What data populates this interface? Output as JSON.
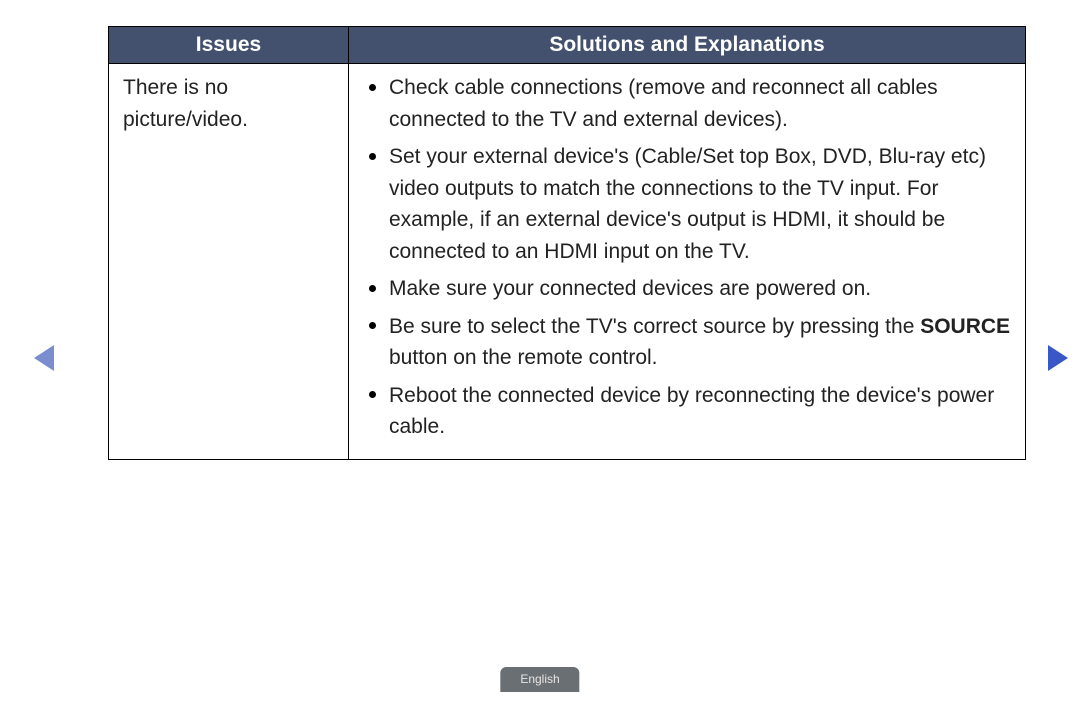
{
  "table": {
    "headers": {
      "issues": "Issues",
      "solutions": "Solutions and Explanations"
    },
    "row": {
      "issue": "There is no picture/video.",
      "solutions": [
        {
          "pre": "Check cable connections (remove and reconnect all cables connected to the TV and external devices).",
          "bold": "",
          "post": ""
        },
        {
          "pre": "Set your external device's (Cable/Set top Box, DVD, Blu-ray etc) video outputs to match the connections to the TV input. For example, if an external device's output is HDMI, it should be connected to an HDMI input on the TV.",
          "bold": "",
          "post": ""
        },
        {
          "pre": "Make sure your connected devices are powered on.",
          "bold": "",
          "post": ""
        },
        {
          "pre": "Be sure to select the TV's correct source by pressing the ",
          "bold": "SOURCE",
          "post": " button on the remote control."
        },
        {
          "pre": "Reboot the connected device by reconnecting the device's power cable.",
          "bold": "",
          "post": ""
        }
      ]
    }
  },
  "language": "English"
}
